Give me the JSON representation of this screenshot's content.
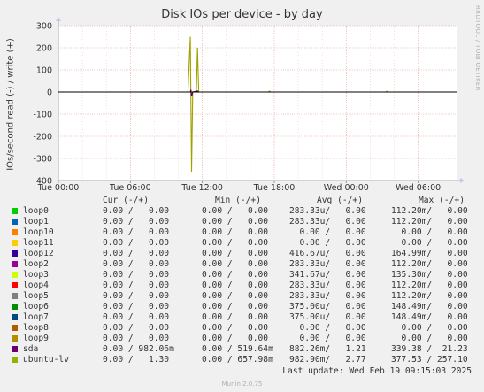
{
  "chart_data": {
    "type": "line",
    "title": "Disk IOs per device - by day",
    "ylabel": "IOs/second read (-) / write (+)",
    "xlabel": "",
    "y_ticks": [
      300,
      200,
      100,
      0,
      -100,
      -200,
      -300,
      -400
    ],
    "ylim": [
      -400,
      300
    ],
    "x_ticks": [
      "Tue 00:00",
      "Tue 06:00",
      "Tue 12:00",
      "Tue 18:00",
      "Wed 00:00",
      "Wed 06:00"
    ],
    "grid": true,
    "series": [
      {
        "name": "ubuntu-lv",
        "color": "#a0a000",
        "points": [
          [
            0,
            0
          ],
          [
            10.8,
            0
          ],
          [
            11.0,
            250
          ],
          [
            11.1,
            -360
          ],
          [
            11.2,
            0
          ],
          [
            11.5,
            0
          ],
          [
            11.6,
            200
          ],
          [
            11.7,
            0
          ],
          [
            17.5,
            0
          ],
          [
            17.6,
            4
          ],
          [
            17.7,
            0
          ],
          [
            27.3,
            0
          ],
          [
            27.4,
            3
          ],
          [
            27.5,
            0
          ],
          [
            33.2,
            0
          ]
        ]
      },
      {
        "name": "sda",
        "color": "#5a005a",
        "points": [
          [
            0,
            0
          ],
          [
            11.0,
            0
          ],
          [
            11.05,
            10
          ],
          [
            11.1,
            -20
          ],
          [
            11.2,
            0
          ],
          [
            11.6,
            5
          ],
          [
            11.7,
            0
          ],
          [
            33.2,
            0
          ]
        ]
      },
      {
        "name": "loop0",
        "color": "#00cc00",
        "points": [
          [
            0,
            0
          ],
          [
            33.2,
            0
          ]
        ]
      }
    ]
  },
  "header": {
    "cur": "Cur (-/+)",
    "min": "Min (-/+)",
    "avg": "Avg (-/+)",
    "max": "Max (-/+)"
  },
  "legend": [
    {
      "name": "loop0",
      "color": "#00cc00",
      "cur": "0.00 /   0.00",
      "min": "0.00 /   0.00",
      "avg": "283.33u/   0.00",
      "max": "112.20m/   0.00"
    },
    {
      "name": "loop1",
      "color": "#0066b3",
      "cur": "0.00 /   0.00",
      "min": "0.00 /   0.00",
      "avg": "283.33u/   0.00",
      "max": "112.20m/   0.00"
    },
    {
      "name": "loop10",
      "color": "#ff8000",
      "cur": "0.00 /   0.00",
      "min": "0.00 /   0.00",
      "avg": "  0.00 /   0.00",
      "max": "  0.00 /   0.00"
    },
    {
      "name": "loop11",
      "color": "#ffcc00",
      "cur": "0.00 /   0.00",
      "min": "0.00 /   0.00",
      "avg": "  0.00 /   0.00",
      "max": "  0.00 /   0.00"
    },
    {
      "name": "loop12",
      "color": "#330099",
      "cur": "0.00 /   0.00",
      "min": "0.00 /   0.00",
      "avg": "416.67u/   0.00",
      "max": "164.99m/   0.00"
    },
    {
      "name": "loop2",
      "color": "#990099",
      "cur": "0.00 /   0.00",
      "min": "0.00 /   0.00",
      "avg": "283.33u/   0.00",
      "max": "112.20m/   0.00"
    },
    {
      "name": "loop3",
      "color": "#ccff00",
      "cur": "0.00 /   0.00",
      "min": "0.00 /   0.00",
      "avg": "341.67u/   0.00",
      "max": "135.30m/   0.00"
    },
    {
      "name": "loop4",
      "color": "#ff0000",
      "cur": "0.00 /   0.00",
      "min": "0.00 /   0.00",
      "avg": "283.33u/   0.00",
      "max": "112.20m/   0.00"
    },
    {
      "name": "loop5",
      "color": "#808080",
      "cur": "0.00 /   0.00",
      "min": "0.00 /   0.00",
      "avg": "283.33u/   0.00",
      "max": "112.20m/   0.00"
    },
    {
      "name": "loop6",
      "color": "#008f00",
      "cur": "0.00 /   0.00",
      "min": "0.00 /   0.00",
      "avg": "375.00u/   0.00",
      "max": "148.49m/   0.00"
    },
    {
      "name": "loop7",
      "color": "#00487d",
      "cur": "0.00 /   0.00",
      "min": "0.00 /   0.00",
      "avg": "375.00u/   0.00",
      "max": "148.49m/   0.00"
    },
    {
      "name": "loop8",
      "color": "#b35a00",
      "cur": "0.00 /   0.00",
      "min": "0.00 /   0.00",
      "avg": "  0.00 /   0.00",
      "max": "  0.00 /   0.00"
    },
    {
      "name": "loop9",
      "color": "#b38f00",
      "cur": "0.00 /   0.00",
      "min": "0.00 /   0.00",
      "avg": "  0.00 /   0.00",
      "max": "  0.00 /   0.00"
    },
    {
      "name": "sda",
      "color": "#6b006b",
      "cur": "0.00 / 982.06m",
      "min": "0.00 / 519.64m",
      "avg": "882.26m/   1.21",
      "max": "339.38 /  21.23"
    },
    {
      "name": "ubuntu-lv",
      "color": "#8fb300",
      "cur": "0.00 /   1.30",
      "min": "0.00 / 657.98m",
      "avg": "982.90m/   2.77",
      "max": "377.53 / 257.10"
    }
  ],
  "footer": {
    "last_update": "Last update: Wed Feb 19 09:15:03 2025",
    "version": "Munin 2.0.75",
    "side_label": "RRDTOOL / TOBI OETIKER"
  }
}
